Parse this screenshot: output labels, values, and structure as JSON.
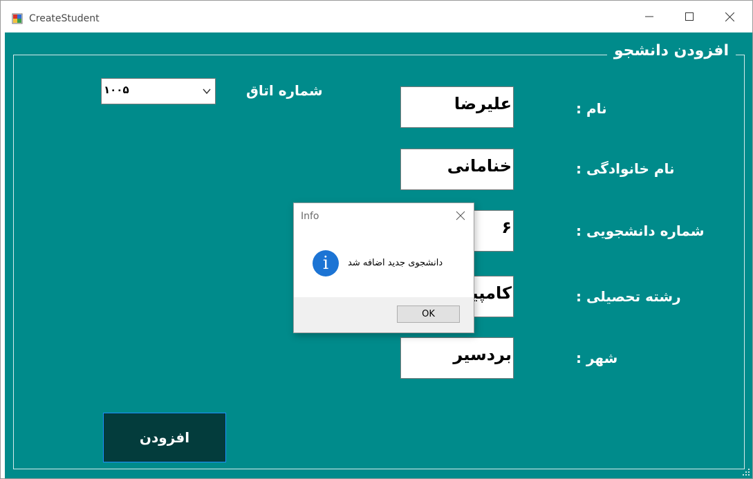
{
  "window": {
    "title": "CreateStudent"
  },
  "form": {
    "group_title": "افزودن دانشجو",
    "fields": {
      "first_name": {
        "label": "نام :",
        "value": "علیرضا"
      },
      "last_name": {
        "label": "نام خانوادگی :",
        "value": "خنامانی"
      },
      "student_number": {
        "label": "شماره دانشجویی :",
        "value": "۶"
      },
      "major": {
        "label": "رشته تحصیلی :",
        "value": "کامپیو"
      },
      "city": {
        "label": "شهر :",
        "value": "بردسیر"
      }
    },
    "room": {
      "label": "شماره اتاق",
      "value": "۱۰۰۵"
    },
    "add_button": "افزودن"
  },
  "message_box": {
    "title": "Info",
    "message": "دانشجوی جدید اضافه شد",
    "ok_label": "OK",
    "icon": "info-icon"
  },
  "colors": {
    "client_background": "#008b8b",
    "button_background": "#033c3c",
    "info_icon": "#1c74d4"
  }
}
